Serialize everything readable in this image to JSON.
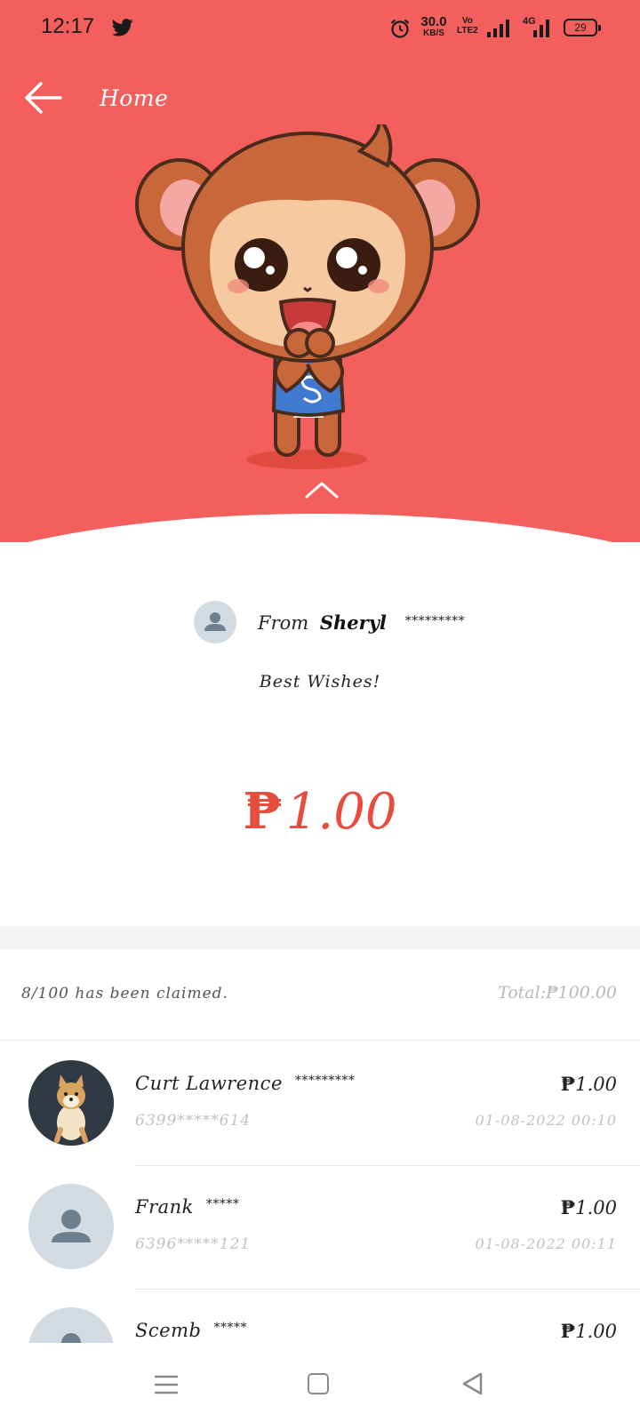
{
  "status_bar": {
    "time": "12:17",
    "net_speed_value": "30.0",
    "net_speed_unit": "KB/S",
    "volte_top": "Vo",
    "volte_bottom": "LTE2",
    "net_type": "4G",
    "battery": "29"
  },
  "nav": {
    "title": "Home"
  },
  "colors": {
    "header_red": "#f25f5c",
    "amount_red": "#e74c3c"
  },
  "envelope": {
    "from_label": "From",
    "sender_name": "Sheryl",
    "sender_mask": "*********",
    "message": "Best Wishes!",
    "currency_symbol": "₱",
    "amount": "1.00"
  },
  "summary": {
    "claimed_text": "8/100 has been claimed.",
    "total_label": "Total:",
    "currency_symbol": "₱",
    "total_amount": "100.00"
  },
  "claims": [
    {
      "name": "Curt Lawrence",
      "mask": "*********",
      "phone": "6399*****614",
      "currency_symbol": "₱",
      "amount": "1.00",
      "time": "01-08-2022 00:10",
      "avatar": "dog-photo-avatar"
    },
    {
      "name": "Frank",
      "mask": "*****",
      "phone": "6396*****121",
      "currency_symbol": "₱",
      "amount": "1.00",
      "time": "01-08-2022 00:11",
      "avatar": "default-person-avatar"
    },
    {
      "name": "Scemb",
      "mask": "*****",
      "phone": "",
      "currency_symbol": "₱",
      "amount": "1.00",
      "time": "",
      "avatar": "default-person-avatar"
    }
  ]
}
